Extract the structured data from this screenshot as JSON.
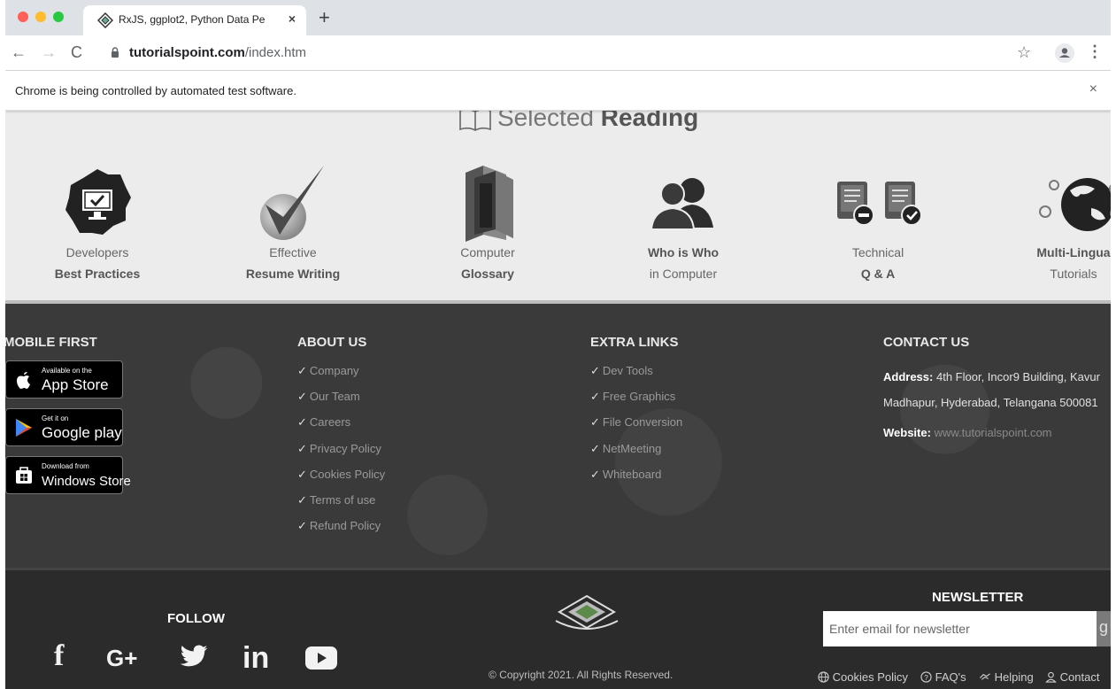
{
  "browser": {
    "tab_title": "RxJS, ggplot2, Python Data Pe",
    "tab_close": "×",
    "new_tab": "+",
    "url_host": "tutorialspoint.com",
    "url_path": "/index.htm",
    "back": "←",
    "forward": "→",
    "reload": "C",
    "star": "☆",
    "menu": "⋮"
  },
  "infobar": {
    "text": "Chrome is being controlled by automated test software.",
    "close": "×"
  },
  "selected_reading": {
    "title_light": "Selected",
    "title_bold": "Reading",
    "items": [
      {
        "line1": "Developers",
        "line2": "Best Practices",
        "icon": "monitor-gear-icon"
      },
      {
        "line1": "Effective",
        "line2": "Resume Writing",
        "icon": "checkmark-icon"
      },
      {
        "line1": "Computer",
        "line2": "Glossary",
        "icon": "books-icon"
      },
      {
        "line1": "Who is Who",
        "line2": "in Computer",
        "icon": "people-icon"
      },
      {
        "line1": "Technical",
        "line2": "Q & A",
        "icon": "documents-icon"
      },
      {
        "line1": "Multi-Lingua",
        "line2": "Tutorials",
        "icon": "globe-icon"
      }
    ]
  },
  "footer": {
    "mobile_first": {
      "title": "MOBILE FIRST",
      "stores": [
        {
          "small": "Available on the",
          "big": "App Store",
          "icon": "apple-icon"
        },
        {
          "small": "Get it on",
          "big": "Google play",
          "icon": "google-play-icon"
        },
        {
          "small": "Download from",
          "big": "Windows Store",
          "icon": "windows-icon"
        }
      ]
    },
    "about_us": {
      "title": "ABOUT US",
      "links": [
        "Company",
        "Our Team",
        "Careers",
        "Privacy Policy",
        "Cookies Policy",
        "Terms of use",
        "Refund Policy"
      ]
    },
    "extra_links": {
      "title": "EXTRA LINKS",
      "links": [
        "Dev Tools",
        "Free Graphics",
        "File Conversion",
        "NetMeeting",
        "Whiteboard"
      ]
    },
    "contact_us": {
      "title": "CONTACT US",
      "address_label": "Address:",
      "address_line1": "4th Floor, Incor9 Building, Kavur",
      "address_line2": "Madhapur, Hyderabad, Telangana 500081",
      "website_label": "Website:",
      "website": "www.tutorialspoint.com"
    },
    "check": "✓"
  },
  "bottom": {
    "follow": "FOLLOW",
    "social": [
      "f",
      "G+",
      "in"
    ],
    "copyright": "© Copyright 2021. All Rights Reserved.",
    "newsletter_title": "NEWSLETTER",
    "newsletter_placeholder": "Enter email for newsletter",
    "newsletter_button": "g",
    "links": [
      "Cookies Policy",
      "FAQ's",
      "Helping",
      "Contact"
    ]
  }
}
